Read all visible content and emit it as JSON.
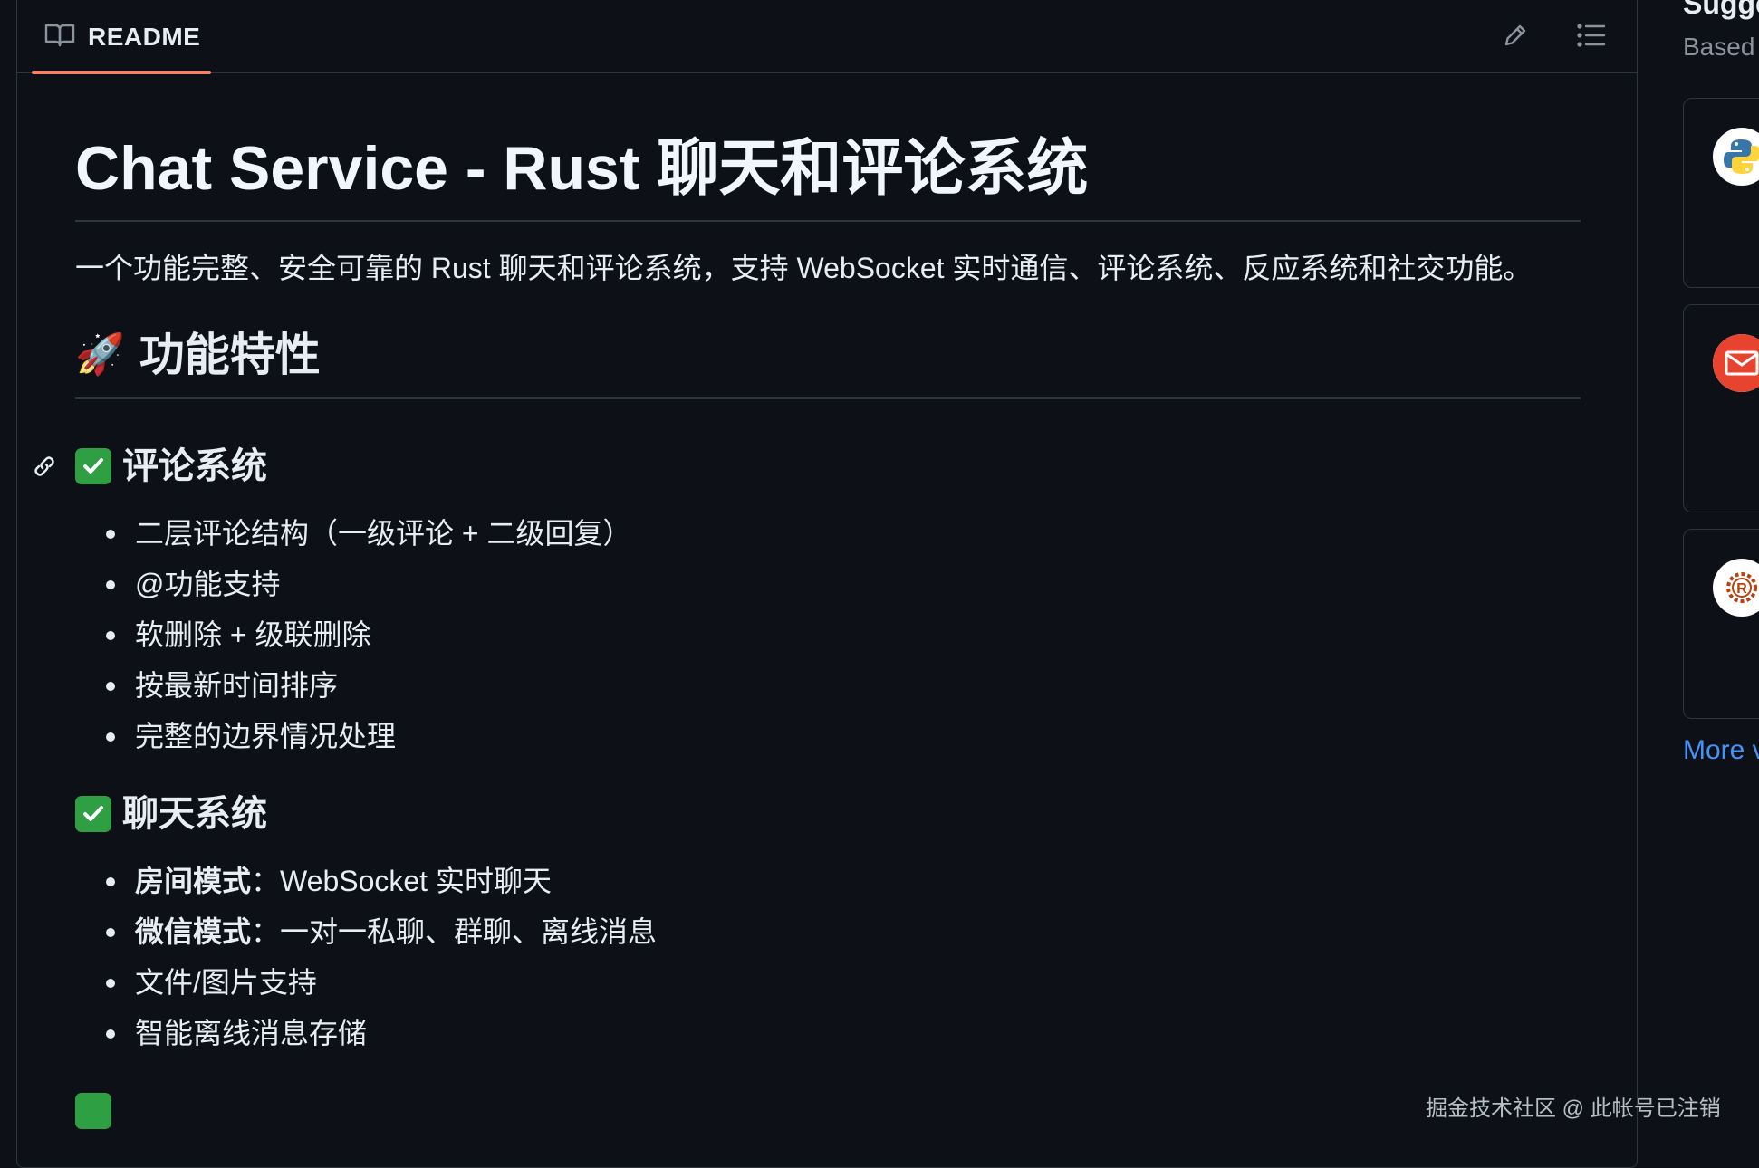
{
  "header": {
    "tab_label": "README",
    "icons": {
      "tab": "book-icon",
      "edit": "pencil-icon",
      "toc": "list-icon"
    },
    "accent_color": "#f78166"
  },
  "article": {
    "title": "Chat Service - Rust 聊天和评论系统",
    "intro": "一个功能完整、安全可靠的 Rust 聊天和评论系统，支持 WebSocket 实时通信、评论系统、反应系统和社交功能。",
    "features_heading": {
      "emoji": "🚀",
      "text": "功能特性"
    },
    "comment_system": {
      "heading": "评论系统",
      "items": [
        "二层评论结构（一级评论 + 二级回复）",
        "@功能支持",
        "软删除 + 级联删除",
        "按最新时间排序",
        "完整的边界情况处理"
      ]
    },
    "chat_system": {
      "heading": "聊天系统",
      "items": [
        {
          "bold": "房间模式",
          "rest": "：WebSocket 实时聊天"
        },
        {
          "bold": "微信模式",
          "rest": "：一对一私聊、群聊、离线消息"
        },
        {
          "bold": "",
          "rest": "文件/图片支持"
        },
        {
          "bold": "",
          "rest": "智能离线消息存储"
        }
      ]
    }
  },
  "sidebar": {
    "title": "Sugge",
    "subtitle": "Based",
    "cards": [
      {
        "icon": "python-icon"
      },
      {
        "icon": "mail-icon"
      },
      {
        "icon": "rust-icon"
      }
    ],
    "more_link": "More v"
  },
  "watermark": "掘金技术社区 @ 此帐号已注销"
}
